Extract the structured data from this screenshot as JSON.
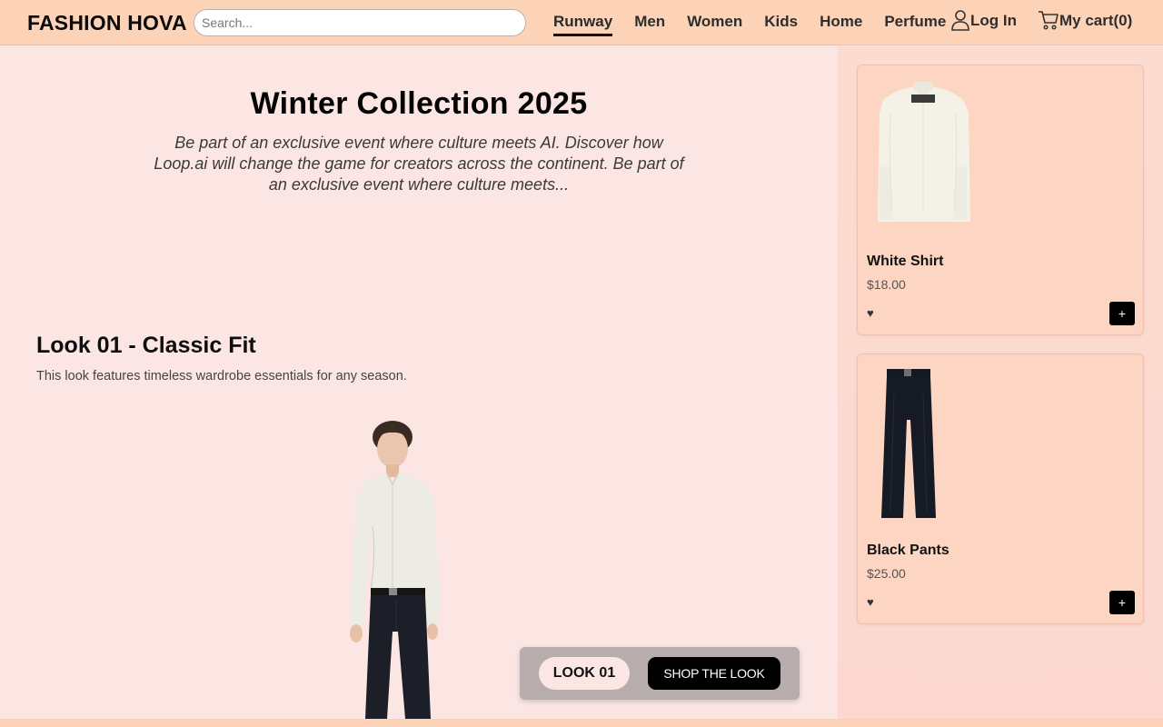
{
  "header": {
    "brand": "FASHION HOVA",
    "search_placeholder": "Search...",
    "nav": [
      {
        "label": "Runway",
        "active": true
      },
      {
        "label": "Men",
        "active": false
      },
      {
        "label": "Women",
        "active": false
      },
      {
        "label": "Kids",
        "active": false
      },
      {
        "label": "Home",
        "active": false
      },
      {
        "label": "Perfume",
        "active": false
      }
    ],
    "login_label": "Log In",
    "login_icon": "user-icon",
    "cart_label": "My cart(0)",
    "cart_icon": "cart-icon"
  },
  "hero": {
    "title": "Winter Collection 2025",
    "text": "Be part of an exclusive event where culture meets AI. Discover how Loop.ai will change the game for creators across the continent. Be part of an exclusive event where culture meets..."
  },
  "look": {
    "title": "Look 01 - Classic Fit",
    "description": "This look features timeless wardrobe essentials for any season.",
    "badge": "LOOK 01",
    "shop_button": "SHOP THE LOOK"
  },
  "products": [
    {
      "name": "White Shirt",
      "price": "$18.00",
      "fav_icon": "heart-icon",
      "add_label": "+"
    },
    {
      "name": "Black Pants",
      "price": "$25.00",
      "fav_icon": "heart-icon",
      "add_label": "+"
    }
  ],
  "colors": {
    "header_bg": "#fdd3b8",
    "main_bg": "#fbe6e4",
    "card_bg": "#fcd6c3",
    "accent": "#000000"
  }
}
